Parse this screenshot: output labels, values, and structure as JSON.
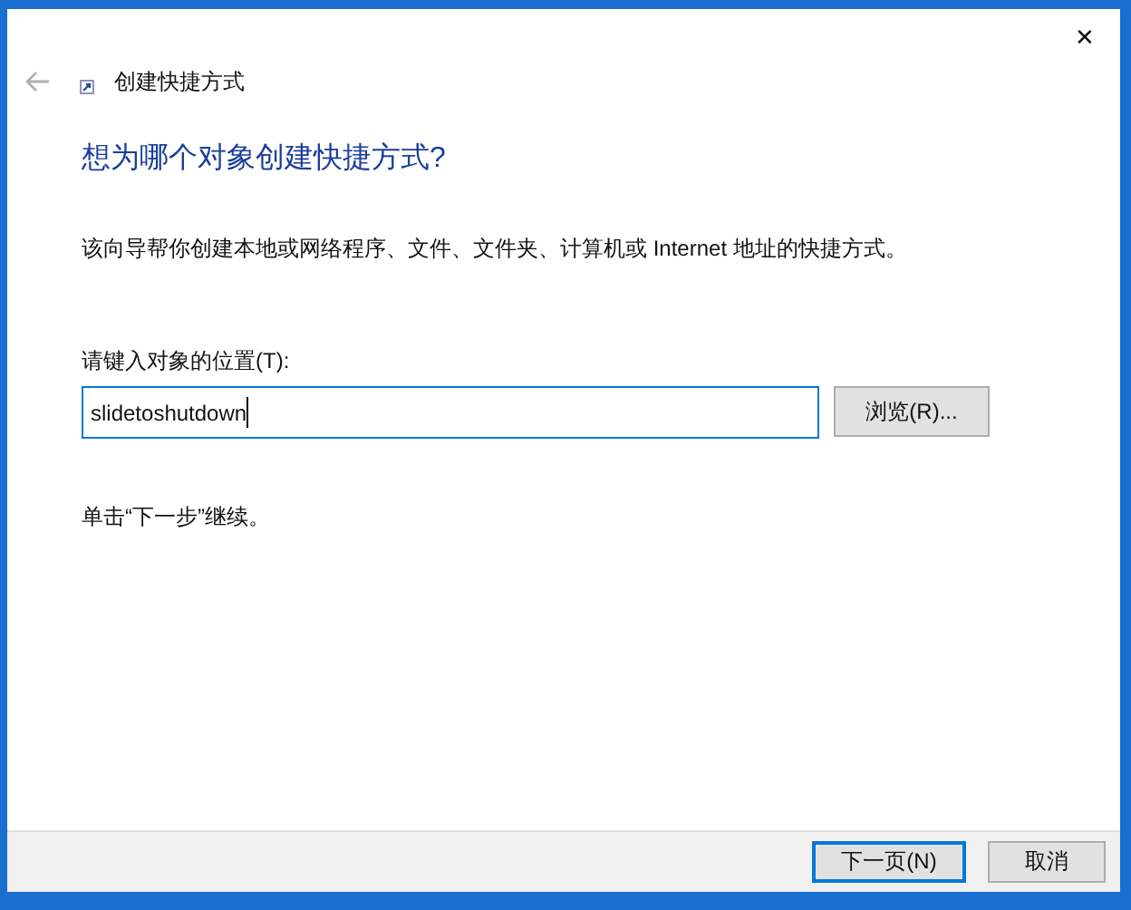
{
  "window": {
    "title": "创建快捷方式",
    "back_disabled": true,
    "close": "✕"
  },
  "heading": "想为哪个对象创建快捷方式?",
  "description": "该向导帮你创建本地或网络程序、文件、文件夹、计算机或 Internet 地址的快捷方式。",
  "location": {
    "label": "请键入对象的位置(T):",
    "value": "slidetoshutdown",
    "focused": true
  },
  "browse_button": "浏览(R)...",
  "hint": "单击“下一步”继续。",
  "buttons": [
    {
      "label": "下一页(N)",
      "default": true
    },
    {
      "label": "取消",
      "default": false
    }
  ]
}
